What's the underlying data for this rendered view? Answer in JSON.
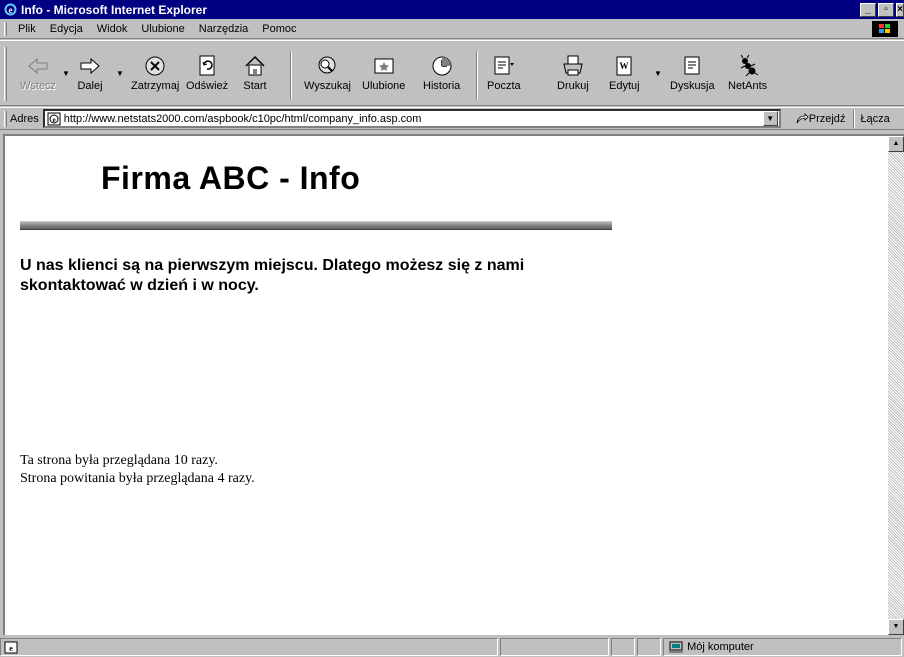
{
  "window": {
    "title": "Info - Microsoft Internet Explorer"
  },
  "menu": [
    "Plik",
    "Edycja",
    "Widok",
    "Ulubione",
    "Narzędzia",
    "Pomoc"
  ],
  "toolbar": {
    "back": "Wstecz",
    "forward": "Dalej",
    "stop": "Zatrzymaj",
    "refresh": "Odśwież",
    "home": "Start",
    "search": "Wyszukaj",
    "favorites": "Ulubione",
    "history": "Historia",
    "mail": "Poczta",
    "print": "Drukuj",
    "edit": "Edytuj",
    "discuss": "Dyskusja",
    "netants": "NetAnts"
  },
  "address": {
    "label": "Adres",
    "url": "http://www.netstats2000.com/aspbook/c10pc/html/company_info.asp.com",
    "go": "Przejdź",
    "links": "Łącza"
  },
  "page": {
    "title": "Firma ABC - Info",
    "slogan": "U nas klienci są na pierwszym miejscu. Dlatego możesz się z nami skontaktować w dzień i w nocy.",
    "stat_line1": "Ta strona była przeglądana 10 razy.",
    "stat_line2": "Strona powitania była przeglądana 4 razy."
  },
  "status": {
    "zone": "Mój komputer"
  }
}
